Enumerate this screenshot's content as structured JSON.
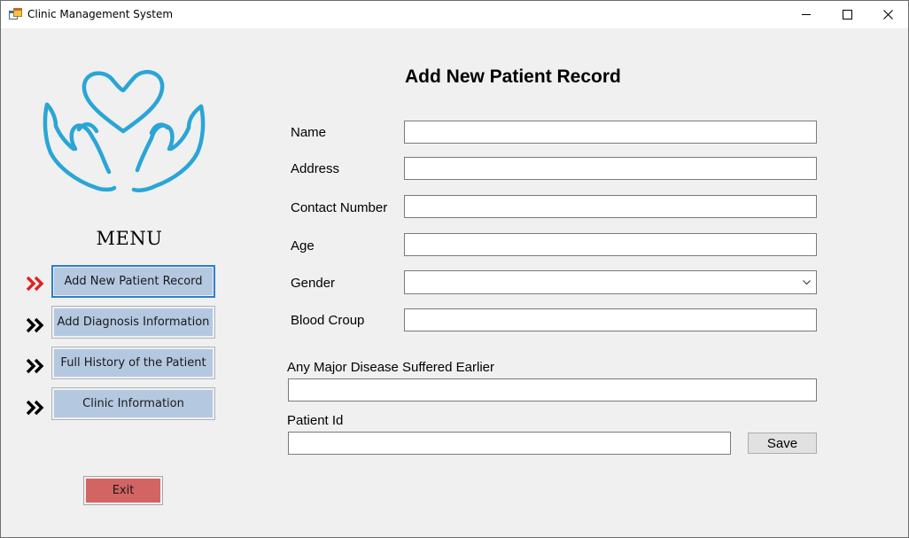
{
  "window": {
    "title": "Clinic Management System",
    "icon": "app-window-icon",
    "controls": [
      "minimize-icon",
      "maximize-icon",
      "close-icon"
    ]
  },
  "sidebar": {
    "logo": "hands-holding-heart-logo",
    "menu_title": "MENU",
    "items": [
      {
        "label": "Add New Patient Record",
        "active": true
      },
      {
        "label": "Add Diagnosis Information",
        "active": false
      },
      {
        "label": "Full History of the Patient",
        "active": false
      },
      {
        "label": "Clinic Information",
        "active": false
      }
    ],
    "exit_label": "Exit"
  },
  "form": {
    "title": "Add New Patient Record",
    "fields": {
      "name": {
        "label": "Name",
        "value": ""
      },
      "address": {
        "label": "Address",
        "value": ""
      },
      "contact": {
        "label": "Contact Number",
        "value": ""
      },
      "age": {
        "label": "Age",
        "value": ""
      },
      "gender": {
        "label": "Gender",
        "value": ""
      },
      "blood": {
        "label": "Blood Croup",
        "value": ""
      },
      "disease": {
        "label": "Any Major Disease Suffered Earlier",
        "value": ""
      },
      "patient_id": {
        "label": "Patient Id",
        "value": ""
      }
    },
    "save_label": "Save"
  },
  "colors": {
    "menu_button": "#b4c8e0",
    "active_border": "#2f7dd0",
    "active_chevron": "#e02020",
    "exit_button": "#d36464",
    "logo": "#2aa5d6"
  }
}
